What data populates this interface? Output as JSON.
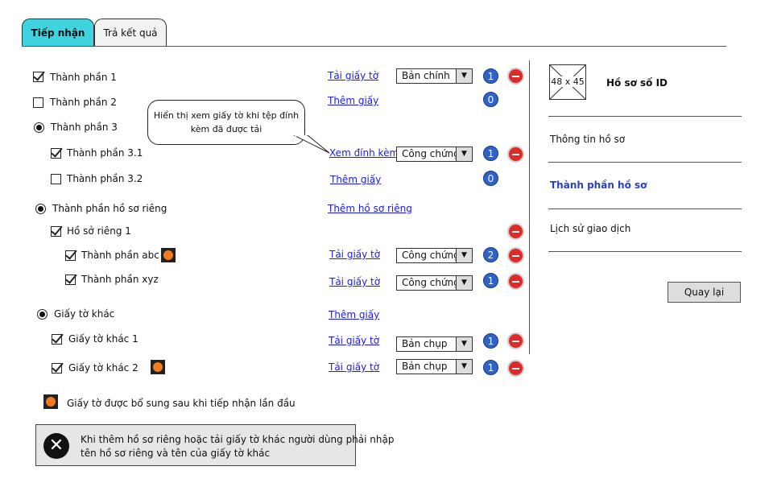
{
  "tabs": {
    "active": "Tiếp nhận",
    "inactive": "Trả kết quả"
  },
  "rows": {
    "tp1": {
      "label": "Thành phần 1",
      "link": "Tải giấy tờ",
      "select": "Bản chính",
      "count": "1"
    },
    "tp2": {
      "label": "Thành phần 2",
      "link": "Thêm giấy",
      "count": "0"
    },
    "tp3": {
      "label": "Thành phần 3"
    },
    "tp31": {
      "label": "Thành phần 3.1",
      "link": "Xem đính kèm",
      "select": "Công chứng",
      "count": "1"
    },
    "tp32": {
      "label": "Thành phần 3.2",
      "link": "Thêm giấy",
      "count": "0"
    },
    "hsr": {
      "label": "Thành phần hồ sơ riêng",
      "link": "Thêm hồ sơ riêng"
    },
    "hsr1": {
      "label": "Hồ sở riêng 1"
    },
    "abc": {
      "label": "Thành phần abc",
      "link": "Tải giấy tờ",
      "select": "Công chứng",
      "count": "2"
    },
    "xyz": {
      "label": "Thành phần xyz",
      "link": "Tải giấy tờ",
      "select": "Công chứng",
      "count": "1"
    },
    "gtk": {
      "label": "Giấy tờ khác",
      "link": "Thêm giấy"
    },
    "gtk1": {
      "label": "Giấy tờ khác 1",
      "link": "Tải giấy tờ",
      "select": "Bản chụp",
      "count": "1"
    },
    "gtk2": {
      "label": "Giấy tờ khác 2",
      "link": "Tải giấy tờ",
      "select": "Bản chụp",
      "count": "1"
    }
  },
  "callout": {
    "line1": "Hiển thị xem giấy tờ khi tệp đính",
    "line2": "kèm đã được tải"
  },
  "legend": "Giấy tờ được bổ sung sau khi tiếp nhận lần đầu",
  "note": {
    "line1": "Khi thêm hồ sơ riêng hoặc tải giấy tờ khác người dùng phải nhập",
    "line2": "tên hồ sơ riêng và tên của giấy tờ khác"
  },
  "sidebar": {
    "image_placeholder": "48 x 45",
    "record_id": "Hồ sơ số ID",
    "items": [
      "Thông tin hồ sơ",
      "Thành phần hồ sơ",
      "Lịch sử giao dịch"
    ],
    "back_button": "Quay lại"
  },
  "colors": {
    "tab_active": "#3fd3e0",
    "link": "#1a1aff",
    "count_badge": "#2f63c6",
    "remove": "#e02a2a",
    "sidebar_active": "#2b3fbf",
    "new_badge": "#f07b20"
  }
}
